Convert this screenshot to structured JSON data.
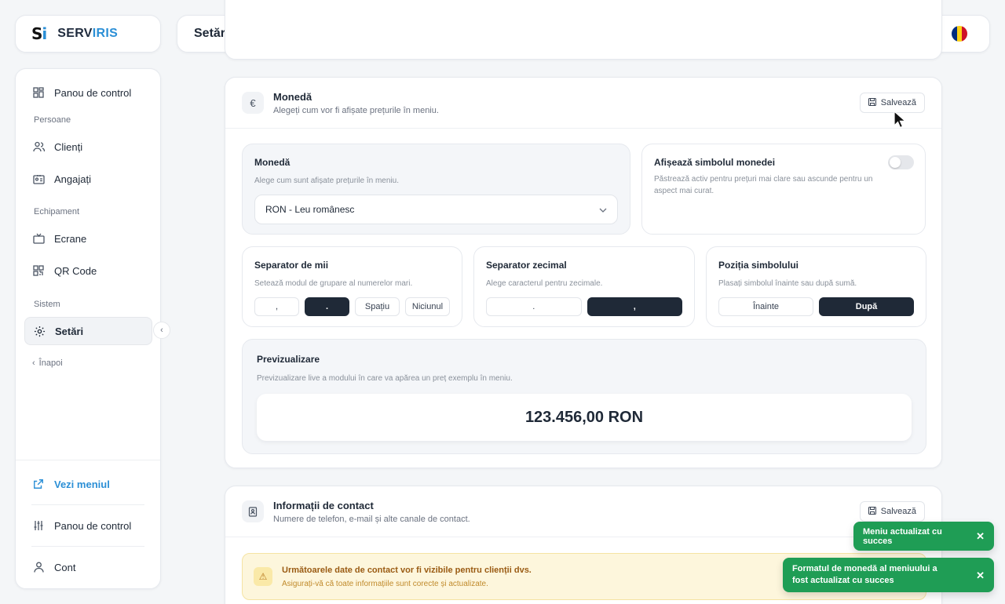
{
  "logo": {
    "mark_s": "S",
    "mark_i": "i",
    "name_a": "SERV",
    "name_b": "IRIS"
  },
  "header": {
    "title": "Setări",
    "icons": [
      "external-link-icon",
      "bell-icon",
      "romania-flag"
    ]
  },
  "sidebar": {
    "items": [
      {
        "label": "Panou de control",
        "icon": "dashboard-icon"
      },
      {
        "label": "Clienți",
        "icon": "users-icon"
      },
      {
        "label": "Angajați",
        "icon": "id-card-icon"
      },
      {
        "label": "Ecrane",
        "icon": "tv-icon"
      },
      {
        "label": "QR Code",
        "icon": "qr-icon"
      },
      {
        "label": "Setări",
        "icon": "gear-icon",
        "active": true
      }
    ],
    "sections": [
      "Persoane",
      "Echipament",
      "Sistem"
    ],
    "back": "Înapoi",
    "bottom": [
      {
        "label": "Vezi meniul",
        "icon": "external-link-icon"
      },
      {
        "label": "Panou de control",
        "icon": "sliders-icon"
      },
      {
        "label": "Cont",
        "icon": "user-icon"
      }
    ]
  },
  "currency": {
    "icon": "€",
    "title": "Monedă",
    "subtitle": "Alegeți cum vor fi afișate prețurile în meniu.",
    "save": "Salvează",
    "select_panel": {
      "title": "Monedă",
      "subtitle": "Alege cum sunt afișate prețurile în meniu.",
      "value": "RON - Leu românesc"
    },
    "symbol_panel": {
      "title": "Afișează simbolul monedei",
      "subtitle": "Păstrează activ pentru prețuri mai clare sau ascunde pentru un aspect mai curat.",
      "enabled": false
    },
    "thousands": {
      "title": "Separator de mii",
      "subtitle": "Setează modul de grupare al numerelor mari.",
      "options": [
        ",",
        ".",
        "Spațiu",
        "Niciunul"
      ],
      "selected": 1
    },
    "decimal": {
      "title": "Separator zecimal",
      "subtitle": "Alege caracterul pentru zecimale.",
      "options": [
        ".",
        ","
      ],
      "selected": 1
    },
    "position": {
      "title": "Poziția simbolului",
      "subtitle": "Plasați simbolul înainte sau după sumă.",
      "options": [
        "Înainte",
        "După"
      ],
      "selected": 1
    },
    "preview": {
      "title": "Previzualizare",
      "subtitle": "Previzualizare live a modului în care va apărea un preț exemplu în meniu.",
      "value": "123.456,00 RON"
    }
  },
  "contact": {
    "title": "Informații de contact",
    "subtitle": "Numere de telefon, e-mail și alte canale de contact.",
    "save": "Salvează",
    "warning_title": "Următoarele date de contact vor fi vizibile pentru clienții dvs.",
    "warning_sub": "Asigurați-vă că toate informațiile sunt corecte și actualizate."
  },
  "toasts": [
    {
      "text": "Meniu actualizat cu succes"
    },
    {
      "text": "Formatul de monedă al meniuului a fost actualizat cu succes"
    }
  ],
  "colors": {
    "accent": "#2b8fd6",
    "dark": "#1f2937",
    "success": "#1f9d55",
    "warning_bg": "#fdf6dc"
  }
}
